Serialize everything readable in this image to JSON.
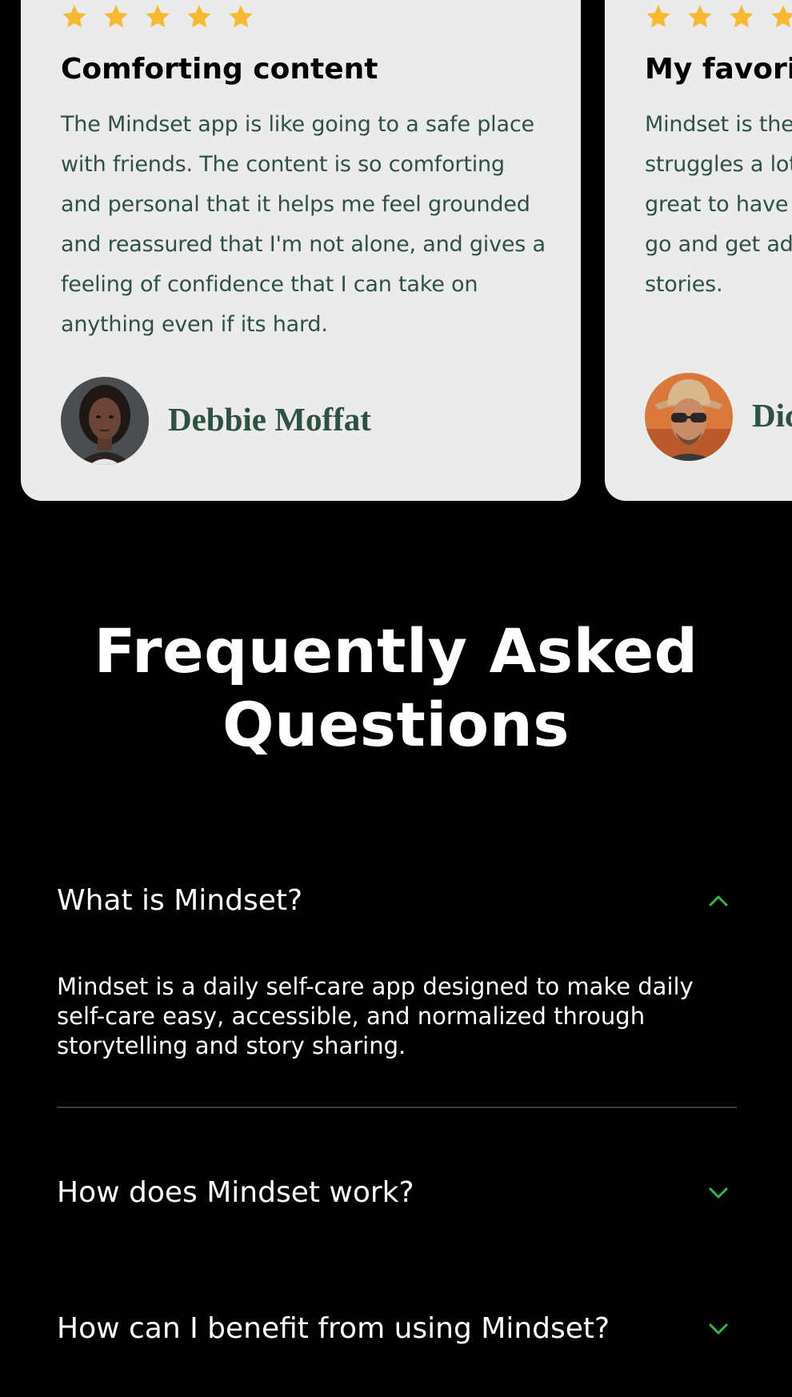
{
  "colors": {
    "page_background": "#000000",
    "card_background": "#ebebeb",
    "star": "#f7b92f",
    "card_text": "#2f5142",
    "accent_chevron": "#2eb94f",
    "divider": "#3a3a3a"
  },
  "testimonials": [
    {
      "rating": 5,
      "title": "Comforting content",
      "body": "The Mindset app is like going to a safe place with friends. The content is so comforting and personal that it helps me feel grounded and reassured that I'm not alone, and gives a feeling of confidence that I can take on anything even if its hard.",
      "author": "Debbie Moffat",
      "avatar_icon": "avatar-woman"
    },
    {
      "rating": 5,
      "title": "My favorit",
      "body_lines": [
        "Mindset is the",
        "struggles a lot",
        "great to have a",
        "go and get adv",
        "stories."
      ],
      "author": "Dic",
      "avatar_icon": "avatar-man-hat-sunglasses"
    }
  ],
  "faq": {
    "title_line1": "Frequently Asked",
    "title_line2": "Questions",
    "items": [
      {
        "question": "What is Mindset?",
        "answer": "Mindset is a daily self-care app designed to make daily self-care easy, accessible, and normalized through storytelling and story sharing.",
        "expanded": true,
        "icon": "chevron-up-icon"
      },
      {
        "question": "How does Mindset work?",
        "expanded": false,
        "icon": "chevron-down-icon"
      },
      {
        "question": "How can I benefit from using Mindset?",
        "expanded": false,
        "icon": "chevron-down-icon"
      }
    ]
  }
}
